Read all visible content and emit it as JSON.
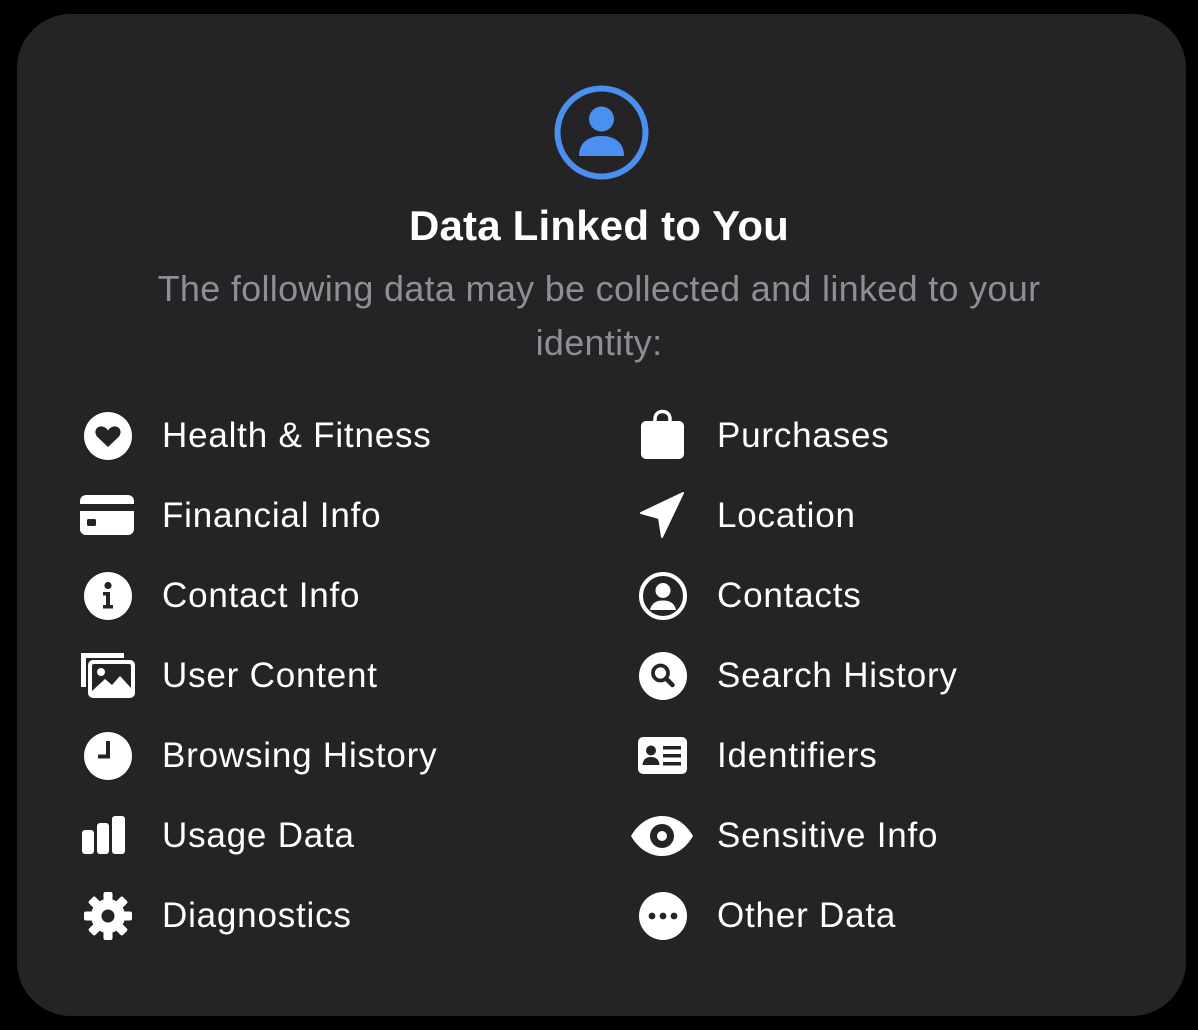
{
  "header": {
    "icon": "person-crop-circle-icon",
    "accent_color": "#4b8ff0",
    "title": "Data Linked to You",
    "subtitle": "The following data may be collected and linked to your identity:"
  },
  "left_column": [
    {
      "label": "Health & Fitness",
      "icon": "heart-icon"
    },
    {
      "label": "Financial Info",
      "icon": "credit-card-icon"
    },
    {
      "label": "Contact Info",
      "icon": "info-icon"
    },
    {
      "label": "User Content",
      "icon": "photos-icon"
    },
    {
      "label": "Browsing History",
      "icon": "clock-icon"
    },
    {
      "label": "Usage Data",
      "icon": "bar-chart-icon"
    },
    {
      "label": "Diagnostics",
      "icon": "gear-icon"
    }
  ],
  "right_column": [
    {
      "label": "Purchases",
      "icon": "shopping-bag-icon"
    },
    {
      "label": "Location",
      "icon": "location-arrow-icon"
    },
    {
      "label": "Contacts",
      "icon": "person-circle-icon"
    },
    {
      "label": "Search History",
      "icon": "search-icon"
    },
    {
      "label": "Identifiers",
      "icon": "id-card-icon"
    },
    {
      "label": "Sensitive Info",
      "icon": "eye-icon"
    },
    {
      "label": "Other Data",
      "icon": "ellipsis-circle-icon"
    }
  ]
}
